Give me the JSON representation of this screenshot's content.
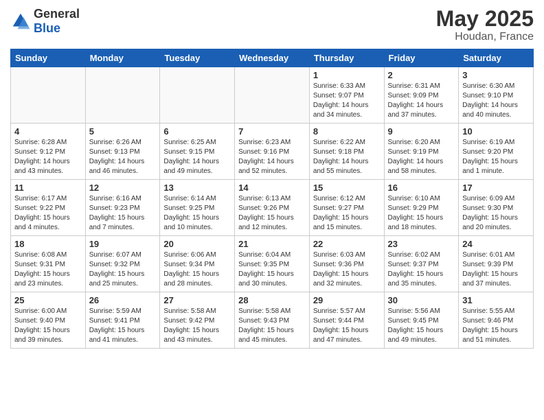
{
  "header": {
    "logo_general": "General",
    "logo_blue": "Blue",
    "title": "May 2025",
    "subtitle": "Houdan, France"
  },
  "weekdays": [
    "Sunday",
    "Monday",
    "Tuesday",
    "Wednesday",
    "Thursday",
    "Friday",
    "Saturday"
  ],
  "weeks": [
    [
      {
        "day": "",
        "info": ""
      },
      {
        "day": "",
        "info": ""
      },
      {
        "day": "",
        "info": ""
      },
      {
        "day": "",
        "info": ""
      },
      {
        "day": "1",
        "info": "Sunrise: 6:33 AM\nSunset: 9:07 PM\nDaylight: 14 hours\nand 34 minutes."
      },
      {
        "day": "2",
        "info": "Sunrise: 6:31 AM\nSunset: 9:09 PM\nDaylight: 14 hours\nand 37 minutes."
      },
      {
        "day": "3",
        "info": "Sunrise: 6:30 AM\nSunset: 9:10 PM\nDaylight: 14 hours\nand 40 minutes."
      }
    ],
    [
      {
        "day": "4",
        "info": "Sunrise: 6:28 AM\nSunset: 9:12 PM\nDaylight: 14 hours\nand 43 minutes."
      },
      {
        "day": "5",
        "info": "Sunrise: 6:26 AM\nSunset: 9:13 PM\nDaylight: 14 hours\nand 46 minutes."
      },
      {
        "day": "6",
        "info": "Sunrise: 6:25 AM\nSunset: 9:15 PM\nDaylight: 14 hours\nand 49 minutes."
      },
      {
        "day": "7",
        "info": "Sunrise: 6:23 AM\nSunset: 9:16 PM\nDaylight: 14 hours\nand 52 minutes."
      },
      {
        "day": "8",
        "info": "Sunrise: 6:22 AM\nSunset: 9:18 PM\nDaylight: 14 hours\nand 55 minutes."
      },
      {
        "day": "9",
        "info": "Sunrise: 6:20 AM\nSunset: 9:19 PM\nDaylight: 14 hours\nand 58 minutes."
      },
      {
        "day": "10",
        "info": "Sunrise: 6:19 AM\nSunset: 9:20 PM\nDaylight: 15 hours\nand 1 minute."
      }
    ],
    [
      {
        "day": "11",
        "info": "Sunrise: 6:17 AM\nSunset: 9:22 PM\nDaylight: 15 hours\nand 4 minutes."
      },
      {
        "day": "12",
        "info": "Sunrise: 6:16 AM\nSunset: 9:23 PM\nDaylight: 15 hours\nand 7 minutes."
      },
      {
        "day": "13",
        "info": "Sunrise: 6:14 AM\nSunset: 9:25 PM\nDaylight: 15 hours\nand 10 minutes."
      },
      {
        "day": "14",
        "info": "Sunrise: 6:13 AM\nSunset: 9:26 PM\nDaylight: 15 hours\nand 12 minutes."
      },
      {
        "day": "15",
        "info": "Sunrise: 6:12 AM\nSunset: 9:27 PM\nDaylight: 15 hours\nand 15 minutes."
      },
      {
        "day": "16",
        "info": "Sunrise: 6:10 AM\nSunset: 9:29 PM\nDaylight: 15 hours\nand 18 minutes."
      },
      {
        "day": "17",
        "info": "Sunrise: 6:09 AM\nSunset: 9:30 PM\nDaylight: 15 hours\nand 20 minutes."
      }
    ],
    [
      {
        "day": "18",
        "info": "Sunrise: 6:08 AM\nSunset: 9:31 PM\nDaylight: 15 hours\nand 23 minutes."
      },
      {
        "day": "19",
        "info": "Sunrise: 6:07 AM\nSunset: 9:32 PM\nDaylight: 15 hours\nand 25 minutes."
      },
      {
        "day": "20",
        "info": "Sunrise: 6:06 AM\nSunset: 9:34 PM\nDaylight: 15 hours\nand 28 minutes."
      },
      {
        "day": "21",
        "info": "Sunrise: 6:04 AM\nSunset: 9:35 PM\nDaylight: 15 hours\nand 30 minutes."
      },
      {
        "day": "22",
        "info": "Sunrise: 6:03 AM\nSunset: 9:36 PM\nDaylight: 15 hours\nand 32 minutes."
      },
      {
        "day": "23",
        "info": "Sunrise: 6:02 AM\nSunset: 9:37 PM\nDaylight: 15 hours\nand 35 minutes."
      },
      {
        "day": "24",
        "info": "Sunrise: 6:01 AM\nSunset: 9:39 PM\nDaylight: 15 hours\nand 37 minutes."
      }
    ],
    [
      {
        "day": "25",
        "info": "Sunrise: 6:00 AM\nSunset: 9:40 PM\nDaylight: 15 hours\nand 39 minutes."
      },
      {
        "day": "26",
        "info": "Sunrise: 5:59 AM\nSunset: 9:41 PM\nDaylight: 15 hours\nand 41 minutes."
      },
      {
        "day": "27",
        "info": "Sunrise: 5:58 AM\nSunset: 9:42 PM\nDaylight: 15 hours\nand 43 minutes."
      },
      {
        "day": "28",
        "info": "Sunrise: 5:58 AM\nSunset: 9:43 PM\nDaylight: 15 hours\nand 45 minutes."
      },
      {
        "day": "29",
        "info": "Sunrise: 5:57 AM\nSunset: 9:44 PM\nDaylight: 15 hours\nand 47 minutes."
      },
      {
        "day": "30",
        "info": "Sunrise: 5:56 AM\nSunset: 9:45 PM\nDaylight: 15 hours\nand 49 minutes."
      },
      {
        "day": "31",
        "info": "Sunrise: 5:55 AM\nSunset: 9:46 PM\nDaylight: 15 hours\nand 51 minutes."
      }
    ]
  ]
}
